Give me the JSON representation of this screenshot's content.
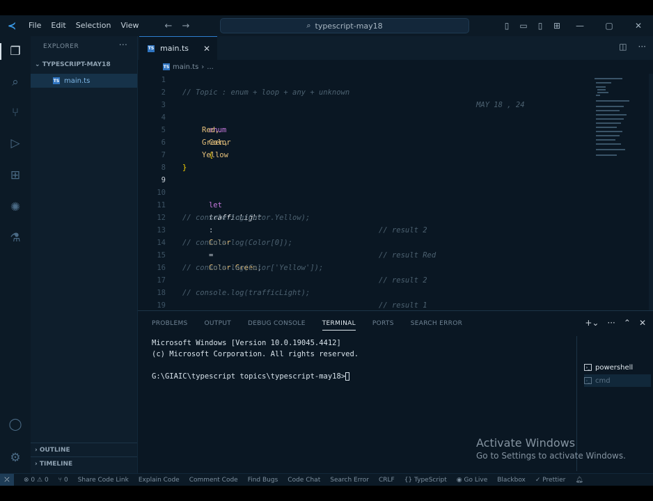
{
  "titlebar": {
    "menu": [
      "File",
      "Edit",
      "Selection",
      "View"
    ],
    "search_text": "typescript-may18"
  },
  "sidebar": {
    "header": "EXPLORER",
    "folder": "TYPESCRIPT-MAY18",
    "file": "main.ts",
    "outline": "OUTLINE",
    "timeline": "TIMELINE"
  },
  "editor": {
    "tab_label": "main.ts",
    "breadcrumb": "main.ts",
    "breadcrumb_tail": "...",
    "header_comment": "// Topic : enum + loop + any + unknown",
    "header_date": "MAY 18 , 24",
    "enum_keyword": "enum",
    "enum_name": "Color",
    "members": [
      "Red,",
      "Green,",
      "Yellow"
    ],
    "let_keyword": "let",
    "var_name": "trafficLight",
    "type_name": "Color",
    "assign_obj": "Color",
    "assign_member": "Green",
    "comments": [
      {
        "line": "11",
        "code": "// console.log(Color.Yellow);",
        "result": "// result 2"
      },
      {
        "line": "13",
        "code": "// console.log(Color[0]);",
        "result": "// result Red"
      },
      {
        "line": "15",
        "code": "// console.log(Color['Yellow']);",
        "result": "// result 2"
      },
      {
        "line": "17",
        "code": "// console.log(trafficLight);",
        "result": "// result 1"
      }
    ],
    "line_numbers": [
      "1",
      "2",
      "3",
      "4",
      "5",
      "6",
      "7",
      "8",
      "9",
      "10",
      "11",
      "12",
      "13",
      "14",
      "15",
      "16",
      "17",
      "18",
      "19"
    ],
    "current_line": "9"
  },
  "panel": {
    "tabs": [
      "PROBLEMS",
      "OUTPUT",
      "DEBUG CONSOLE",
      "TERMINAL",
      "PORTS",
      "SEARCH ERROR"
    ],
    "active_tab": "TERMINAL",
    "terminal_lines": [
      "Microsoft Windows [Version 10.0.19045.4412]",
      "(c) Microsoft Corporation. All rights reserved.",
      "",
      "G:\\GIAIC\\typescript topics\\typescript-may18>"
    ],
    "terminals": [
      "powershell",
      "cmd"
    ]
  },
  "watermark": {
    "line1": "Activate Windows",
    "line2": "Go to Settings to activate Windows."
  },
  "statusbar": {
    "errors": "0",
    "warnings": "0",
    "ports": "0",
    "items": [
      "Share Code Link",
      "Explain Code",
      "Comment Code",
      "Find Bugs",
      "Code Chat",
      "Search Error",
      "CRLF",
      "TypeScript",
      "Go Live",
      "Blackbox",
      "Prettier"
    ]
  }
}
